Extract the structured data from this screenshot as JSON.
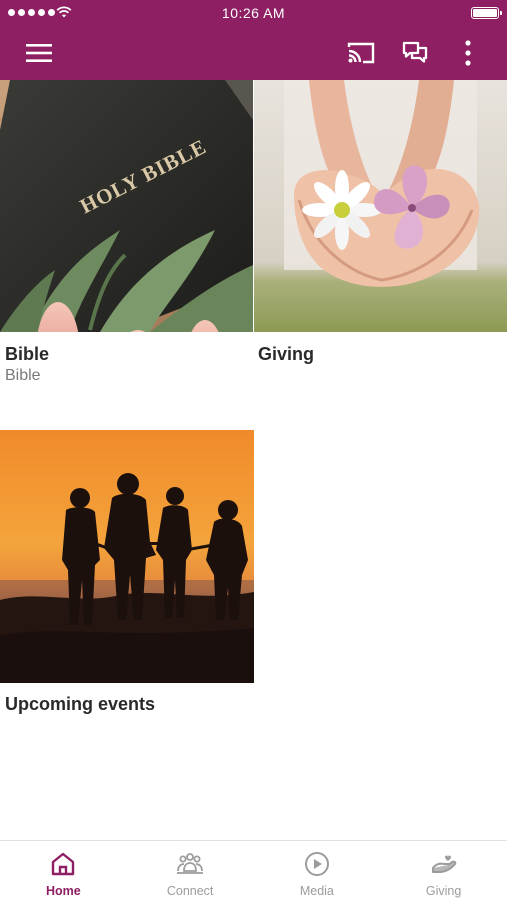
{
  "status_bar": {
    "time": "10:26 AM"
  },
  "app_bar": {
    "menu_icon": "hamburger-menu-icon",
    "cast_icon": "cast-icon",
    "chat_icon": "chat-bubbles-icon",
    "more_icon": "more-vertical-icon"
  },
  "tiles": [
    {
      "title": "Bible",
      "subtitle": "Bible",
      "image_text": "HOLY BIBLE"
    },
    {
      "title": "Giving",
      "subtitle": ""
    },
    {
      "title": "Upcoming events",
      "subtitle": ""
    }
  ],
  "bottom_nav": {
    "items": [
      {
        "label": "Home",
        "icon": "home-icon",
        "active": true
      },
      {
        "label": "Connect",
        "icon": "people-icon",
        "active": false
      },
      {
        "label": "Media",
        "icon": "play-circle-icon",
        "active": false
      },
      {
        "label": "Giving",
        "icon": "giving-hand-icon",
        "active": false
      }
    ]
  },
  "colors": {
    "brand": "#8e1f63",
    "inactive": "#9c9c9c",
    "title_text": "#2a2a2a",
    "subtitle_text": "#7a7a7a"
  }
}
